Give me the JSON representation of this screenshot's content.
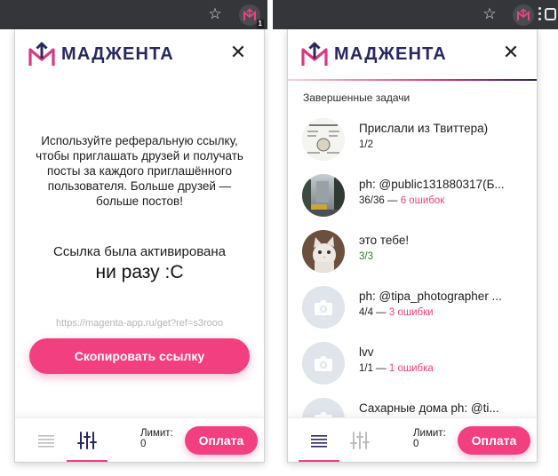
{
  "brand": "МАДЖЕНТА",
  "colors": {
    "accent": "#f23f7f",
    "brand_dark": "#27285f",
    "success": "#2e7d32"
  },
  "browser": {
    "ext_badge": "1",
    "icons": [
      "star-icon",
      "extension-icon",
      "kebab-icon"
    ]
  },
  "left": {
    "ref_text": "Используйте реферальную ссылку, чтобы приглашать друзей и получать посты за каждого приглашённого пользователя. Больше друзей — больше постов!",
    "activated_label": "Ссылка была активирована",
    "activated_count": "ни разу :С",
    "ref_link": "https://magenta-app.ru/get?ref=s3rooo",
    "copy_button": "Скопировать ссылку"
  },
  "right": {
    "section_title": "Завершенные задачи",
    "items": [
      {
        "title": "Прислали из Твиттера)",
        "progress": "1/2",
        "errors": "",
        "ok": false,
        "thumb": "meme"
      },
      {
        "title": "ph: @public131880317(Б...",
        "progress": "36/36 —",
        "errors": "6 ошибок",
        "ok": false,
        "thumb": "street"
      },
      {
        "title": "это тебе!",
        "progress": "3/3",
        "errors": "",
        "ok": true,
        "thumb": "cat"
      },
      {
        "title": "ph: @tipa_photographer ...",
        "progress": "4/4 —",
        "errors": "3 ошибки",
        "ok": false,
        "thumb": "placeholder"
      },
      {
        "title": "lvv",
        "progress": "1/1 —",
        "errors": "1 ошибка",
        "ok": false,
        "thumb": "placeholder"
      },
      {
        "title": "Сахарные дома ph: @ti...",
        "progress": "",
        "errors": "",
        "ok": false,
        "thumb": "placeholder"
      }
    ]
  },
  "footer": {
    "limit_label": "Лимит:",
    "limit_value": "0",
    "pay_button": "Оплата"
  }
}
